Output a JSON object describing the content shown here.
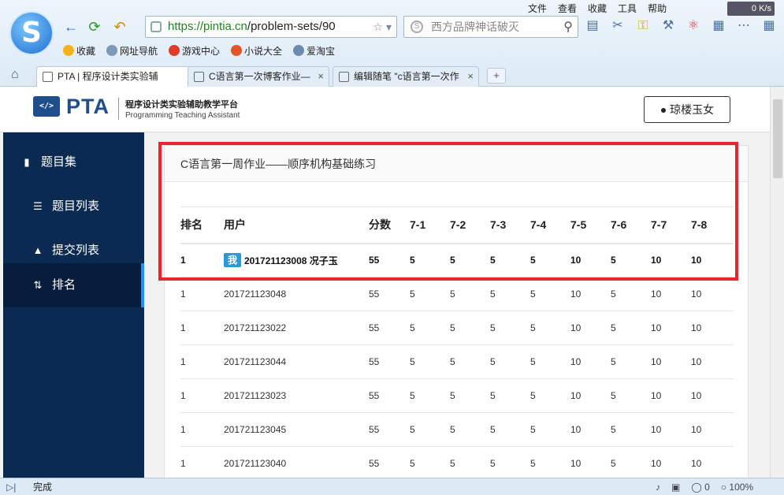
{
  "browser": {
    "menu": [
      "文件",
      "查看",
      "收藏",
      "工具",
      "帮助"
    ],
    "speed": "0 K/s",
    "url_host": "https://pintia.cn",
    "url_path": "/problem-sets/90",
    "search_placeholder": "西方品牌神话破灭",
    "bookmarks": [
      {
        "label": "收藏",
        "color": "#f5b21b"
      },
      {
        "label": "网址导航",
        "color": "#7a9ab8"
      },
      {
        "label": "游戏中心",
        "color": "#e23b2a"
      },
      {
        "label": "小说大全",
        "color": "#e2542a"
      },
      {
        "label": "爱淘宝",
        "color": "#6b8bb0"
      }
    ],
    "tabs": [
      {
        "label": "PTA | 程序设计类实验辅"
      },
      {
        "label": "C语言第一次博客作业—"
      },
      {
        "label": "编辑随笔 \"c语言第一次作"
      }
    ],
    "status_text": "完成",
    "status_zero": "0",
    "zoom": "100%"
  },
  "site": {
    "logo_word": "PTA",
    "subtitle_cn": "程序设计类实验辅助教学平台",
    "subtitle_en": "Programming Teaching Assistant",
    "user_name": "琼楼玉女"
  },
  "sidebar": {
    "items": [
      {
        "label": "题目集",
        "icon": "book-icon"
      },
      {
        "label": "题目列表",
        "icon": "list-icon"
      },
      {
        "label": "提交列表",
        "icon": "upload-icon"
      },
      {
        "label": "排名",
        "icon": "sort-icon"
      }
    ]
  },
  "card": {
    "title": "C语言第一周作业——顺序机构基础练习",
    "me_badge": "我"
  },
  "table": {
    "headers": [
      "排名",
      "用户",
      "分数",
      "7-1",
      "7-2",
      "7-3",
      "7-4",
      "7-5",
      "7-6",
      "7-7",
      "7-8"
    ],
    "rows": [
      [
        "1",
        "201721123008 况子玉",
        "55",
        "5",
        "5",
        "5",
        "5",
        "10",
        "5",
        "10",
        "10"
      ],
      [
        "1",
        "201721123048",
        "55",
        "5",
        "5",
        "5",
        "5",
        "10",
        "5",
        "10",
        "10"
      ],
      [
        "1",
        "201721123022",
        "55",
        "5",
        "5",
        "5",
        "5",
        "10",
        "5",
        "10",
        "10"
      ],
      [
        "1",
        "201721123044",
        "55",
        "5",
        "5",
        "5",
        "5",
        "10",
        "5",
        "10",
        "10"
      ],
      [
        "1",
        "201721123023",
        "55",
        "5",
        "5",
        "5",
        "5",
        "10",
        "5",
        "10",
        "10"
      ],
      [
        "1",
        "201721123045",
        "55",
        "5",
        "5",
        "5",
        "5",
        "10",
        "5",
        "10",
        "10"
      ],
      [
        "1",
        "201721123040",
        "55",
        "5",
        "5",
        "5",
        "5",
        "10",
        "5",
        "10",
        "10"
      ]
    ]
  },
  "colors": {
    "accent": "#1f4e8c",
    "sidebar": "#0b2a52",
    "highlight": "#e8262e",
    "badge": "#2d9ad8"
  }
}
